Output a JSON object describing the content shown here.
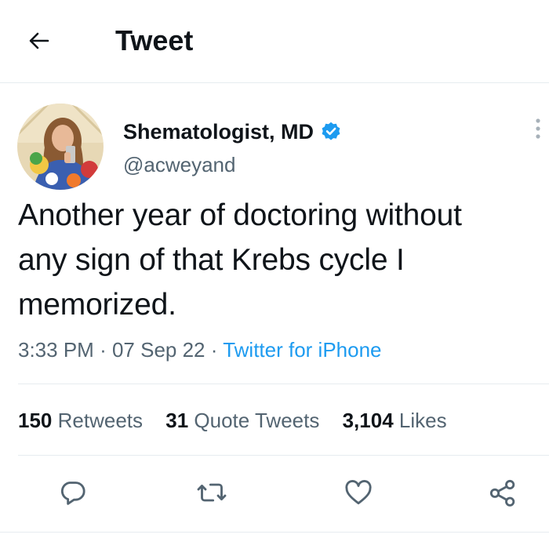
{
  "header": {
    "title": "Tweet",
    "back_icon": "arrow-left-icon"
  },
  "author": {
    "display_name": "Shematologist, MD",
    "handle": "@acweyand",
    "verified": true,
    "verified_color": "#1d9bf0",
    "avatar_icon": "profile-photo"
  },
  "tweet": {
    "text": "Another year of doctoring without\nany sign of that Krebs cycle I\nmemorized.",
    "time": "3:33 PM",
    "separator": "·",
    "date": "07 Sep 22",
    "source": "Twitter for iPhone"
  },
  "stats": {
    "retweets": {
      "count": "150",
      "label": "Retweets"
    },
    "quote_tweets": {
      "count": "31",
      "label": "Quote Tweets"
    },
    "likes": {
      "count": "3,104",
      "label": "Likes"
    }
  },
  "actions": {
    "reply_icon": "reply-icon",
    "retweet_icon": "retweet-icon",
    "like_icon": "heart-icon",
    "share_icon": "share-icon"
  },
  "colors": {
    "accent": "#1d9bf0",
    "secondary_text": "#536471",
    "primary_text": "#0f1419",
    "divider": "#e6ecf0"
  }
}
